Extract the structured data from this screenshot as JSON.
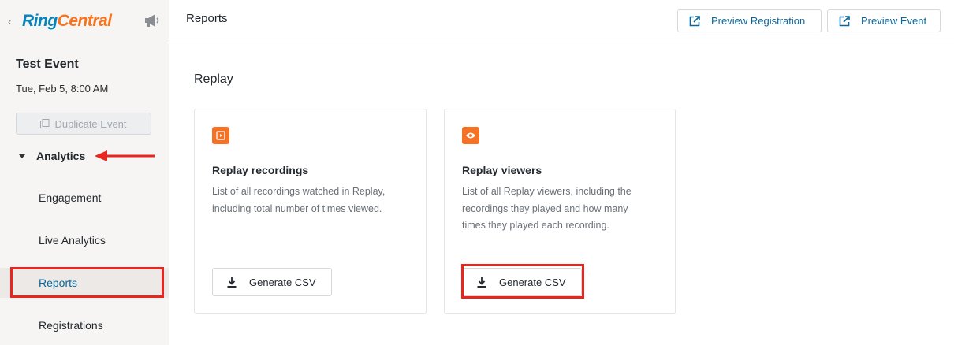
{
  "brand": {
    "part1": "Ring",
    "part2": "Central"
  },
  "icons": {
    "back": "chevron-left-icon",
    "megaphone": "megaphone-icon",
    "duplicate": "copy-icon",
    "external": "external-link-icon",
    "download": "download-icon",
    "recordings": "play-square-icon",
    "viewers": "eye-icon"
  },
  "colors": {
    "brand_blue": "#0684bc",
    "brand_orange": "#f7731c",
    "accent": "#0b6699",
    "card_icon": "#f47125",
    "highlight": "#e8261f"
  },
  "sidebar": {
    "event_title": "Test Event",
    "event_date": "Tue, Feb 5, 8:00 AM",
    "duplicate_label": "Duplicate Event",
    "section_label": "Analytics",
    "items": [
      {
        "label": "Engagement"
      },
      {
        "label": "Live Analytics"
      },
      {
        "label": "Reports"
      },
      {
        "label": "Registrations"
      }
    ]
  },
  "header": {
    "title": "Reports",
    "preview_registration": "Preview Registration",
    "preview_event": "Preview Event"
  },
  "main": {
    "section_title": "Replay",
    "cards": [
      {
        "title": "Replay recordings",
        "desc_lines": [
          "List of all recordings watched in Replay,",
          "including total number of times viewed."
        ],
        "button": "Generate CSV"
      },
      {
        "title": "Replay viewers",
        "desc_lines": [
          "List of all Replay viewers, including the",
          "recordings they played and how many",
          "times they played each recording."
        ],
        "button": "Generate CSV"
      }
    ]
  }
}
